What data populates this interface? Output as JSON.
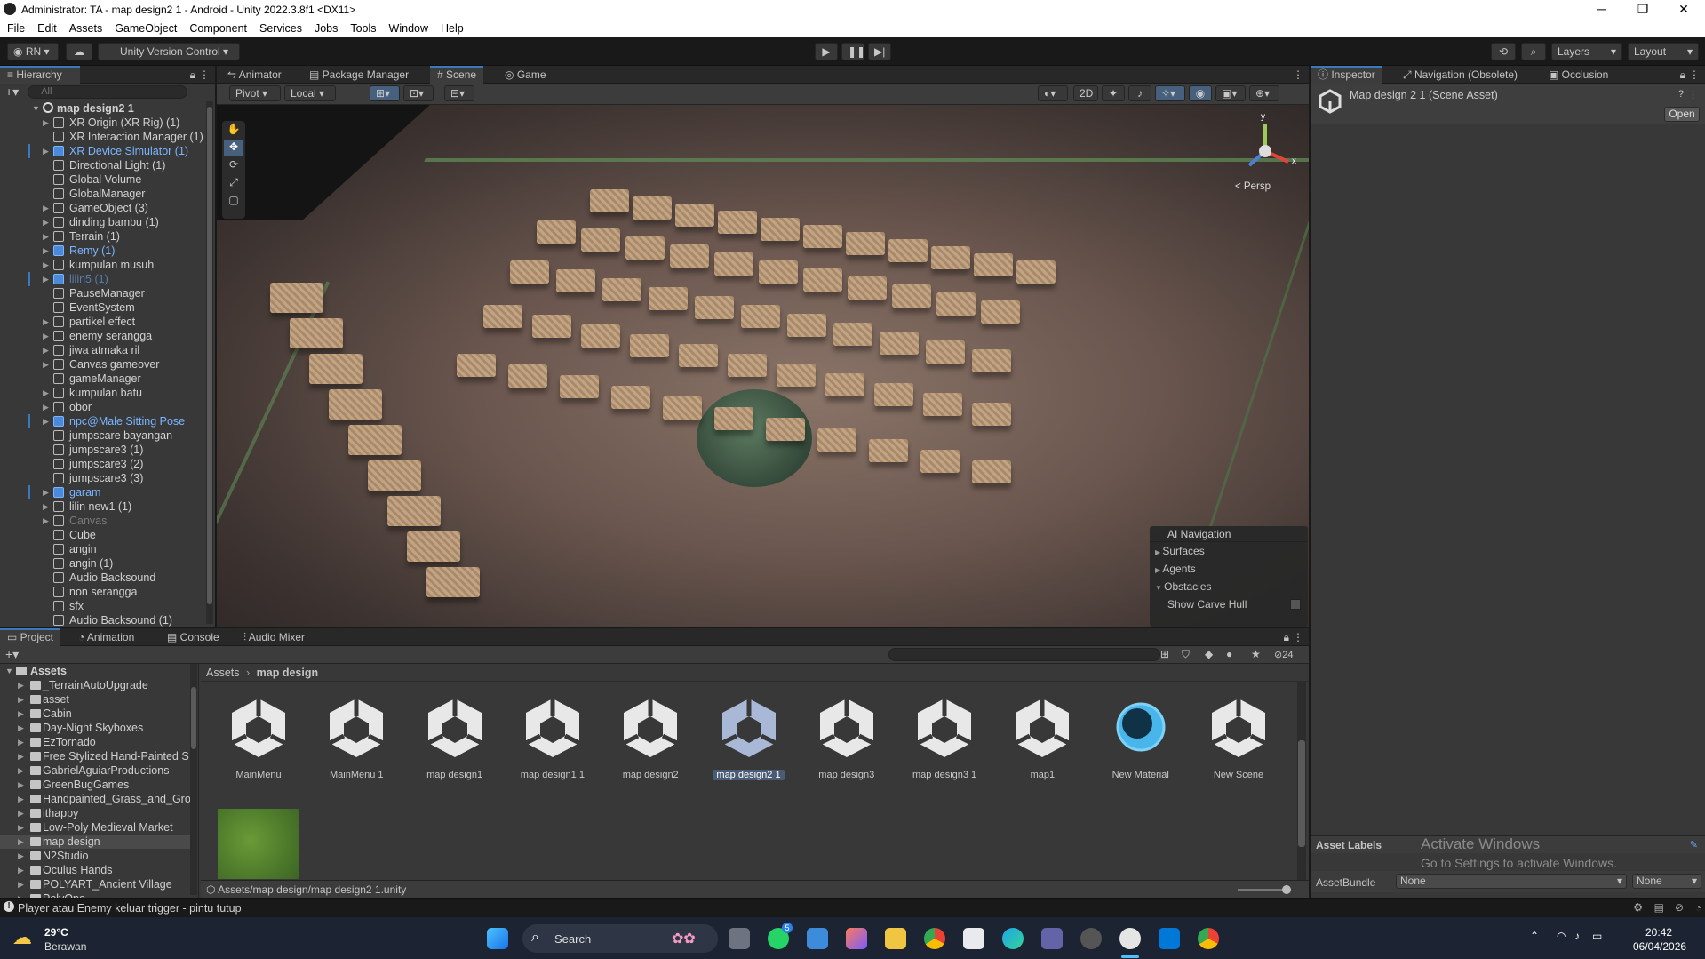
{
  "window": {
    "title": "Administrator: TA - map design2 1 - Android - Unity 2022.3.8f1 <DX11>",
    "minimize": "─",
    "maximize": "❐",
    "close": "✕"
  },
  "menu": [
    "File",
    "Edit",
    "Assets",
    "GameObject",
    "Component",
    "Services",
    "Jobs",
    "Tools",
    "Window",
    "Help"
  ],
  "toolbar": {
    "account": "RN",
    "version_control": "Unity Version Control",
    "layers": "Layers",
    "layout": "Layout"
  },
  "hierarchy": {
    "tab": "Hierarchy",
    "search_placeholder": "All",
    "scene_name": "map design2 1",
    "items": [
      {
        "label": "XR Origin (XR Rig) (1)",
        "arrow": "▶"
      },
      {
        "label": "XR Interaction Manager (1)",
        "arrow": ""
      },
      {
        "label": "XR Device Simulator (1)",
        "arrow": "▶"
      },
      {
        "label": "Directional Light (1)",
        "arrow": ""
      },
      {
        "label": "Global Volume",
        "arrow": ""
      },
      {
        "label": "GlobalManager",
        "arrow": ""
      },
      {
        "label": "GameObject (3)",
        "arrow": "▶"
      },
      {
        "label": "dinding bambu (1)",
        "arrow": "▶"
      },
      {
        "label": "Terrain (1)",
        "arrow": "▶"
      },
      {
        "label": "Remy (1)",
        "arrow": "▶"
      },
      {
        "label": "kumpulan musuh",
        "arrow": "▶"
      },
      {
        "label": "lilin5 (1)",
        "arrow": "▶"
      },
      {
        "label": "PauseManager",
        "arrow": ""
      },
      {
        "label": "EventSystem",
        "arrow": ""
      },
      {
        "label": "partikel effect",
        "arrow": "▶"
      },
      {
        "label": "enemy serangga",
        "arrow": "▶"
      },
      {
        "label": "jiwa atmaka ril",
        "arrow": "▶"
      },
      {
        "label": "Canvas gameover",
        "arrow": "▶"
      },
      {
        "label": "gameManager",
        "arrow": ""
      },
      {
        "label": "kumpulan batu",
        "arrow": "▶"
      },
      {
        "label": "obor",
        "arrow": "▶"
      },
      {
        "label": "npc@Male Sitting Pose",
        "arrow": "▶"
      },
      {
        "label": "jumpscare bayangan",
        "arrow": ""
      },
      {
        "label": "jumpscare3 (1)",
        "arrow": ""
      },
      {
        "label": "jumpscare3 (2)",
        "arrow": ""
      },
      {
        "label": "jumpscare3 (3)",
        "arrow": ""
      },
      {
        "label": "garam",
        "arrow": "▶"
      },
      {
        "label": "lilin new1 (1)",
        "arrow": "▶"
      },
      {
        "label": "Canvas",
        "arrow": "▶"
      },
      {
        "label": "Cube",
        "arrow": ""
      },
      {
        "label": "angin",
        "arrow": ""
      },
      {
        "label": "angin (1)",
        "arrow": ""
      },
      {
        "label": "Audio Backsound",
        "arrow": ""
      },
      {
        "label": "non serangga",
        "arrow": ""
      },
      {
        "label": "sfx",
        "arrow": ""
      },
      {
        "label": "Audio Backsound (1)",
        "arrow": ""
      }
    ]
  },
  "scene_tabs": [
    "Animator",
    "Package Manager",
    "Scene",
    "Game"
  ],
  "scene_toolbar": {
    "pivot": "Pivot",
    "local": "Local",
    "mode2d": "2D"
  },
  "gizmo": {
    "projection": "Persp",
    "x": "x",
    "y": "y"
  },
  "ai_navigation": {
    "title": "AI Navigation",
    "items": [
      "Surfaces",
      "Agents",
      "Obstacles"
    ],
    "show_carve_hull": "Show Carve Hull"
  },
  "inspector": {
    "tabs": [
      "Inspector",
      "Navigation (Obsolete)",
      "Occlusion"
    ],
    "asset_title": "Map design 2 1 (Scene Asset)",
    "open_button": "Open",
    "asset_labels": "Asset Labels",
    "asset_bundle": "AssetBundle",
    "bundle_value": "None",
    "variant_value": "None",
    "activate_title": "Activate Windows",
    "activate_sub": "Go to Settings to activate Windows."
  },
  "bottom_tabs": [
    "Project",
    "Animation",
    "Console",
    "Audio Mixer"
  ],
  "project": {
    "root": "Assets",
    "folders": [
      "_TerrainAutoUpgrade",
      "asset",
      "Cabin",
      "Day-Night Skyboxes",
      "EzTornado",
      "Free Stylized Hand-Painted S",
      "GabrielAguiarProductions",
      "GreenBugGames",
      "Handpainted_Grass_and_Grou",
      "ithappy",
      "Low-Poly Medieval Market",
      "map design",
      "N2Studio",
      "Oculus Hands",
      "POLYART_Ancient Village",
      "PolyOne"
    ],
    "breadcrumb_root": "Assets",
    "breadcrumb_current": "map design",
    "hidden_count": "24",
    "assets": [
      {
        "name": "MainMenu",
        "kind": "scene"
      },
      {
        "name": "MainMenu 1",
        "kind": "scene"
      },
      {
        "name": "map design1",
        "kind": "scene"
      },
      {
        "name": "map design1 1",
        "kind": "scene"
      },
      {
        "name": "map design2",
        "kind": "scene"
      },
      {
        "name": "map design2 1",
        "kind": "scene",
        "selected": true
      },
      {
        "name": "map design3",
        "kind": "scene"
      },
      {
        "name": "map design3 1",
        "kind": "scene"
      },
      {
        "name": "map1",
        "kind": "scene"
      },
      {
        "name": "New Material",
        "kind": "material"
      },
      {
        "name": "New Scene",
        "kind": "scene"
      }
    ],
    "path": "Assets/map design/map design2 1.unity"
  },
  "status": {
    "message": "Player atau Enemy keluar trigger - pintu tutup"
  },
  "taskbar": {
    "temperature": "29°C",
    "weather": "Berawan",
    "search_label": "Search",
    "time": "20:42",
    "date": "06/04/2026",
    "badge": "5"
  },
  "colors": {
    "accent": "#3a79bb",
    "selection": "#2c5d87",
    "prefab_text": "#7ab5ff",
    "panel": "#383838"
  }
}
